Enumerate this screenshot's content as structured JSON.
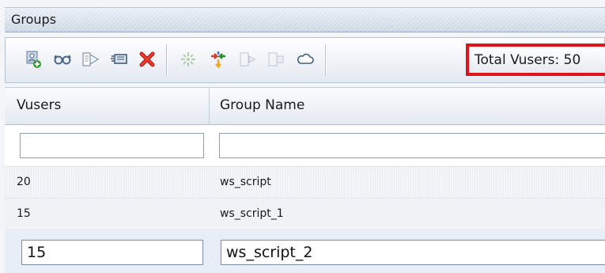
{
  "panel": {
    "title": "Groups"
  },
  "toolbar": {
    "buttons": [
      {
        "name": "add-group",
        "icon": "add-group-icon"
      },
      {
        "name": "view-script",
        "icon": "glasses-icon"
      },
      {
        "name": "run-script",
        "icon": "play-script-icon"
      },
      {
        "name": "edit-runtime",
        "icon": "edit-icon"
      },
      {
        "name": "delete-group",
        "icon": "delete-x-icon"
      },
      {
        "name": "distribute",
        "icon": "distribute-icon"
      },
      {
        "name": "change-script",
        "icon": "arrows-icon"
      },
      {
        "name": "start-group",
        "icon": "start-group-icon"
      },
      {
        "name": "stop-group",
        "icon": "stop-group-icon"
      },
      {
        "name": "cloud",
        "icon": "cloud-icon"
      }
    ],
    "total_vusers_label": "Total Vusers: 50",
    "highlight_color": "#e0131a"
  },
  "table": {
    "columns": [
      "Vusers",
      "Group Name"
    ],
    "filter": {
      "vusers": "",
      "group_name": ""
    },
    "rows": [
      {
        "vusers": "20",
        "group_name": "ws_script"
      },
      {
        "vusers": "15",
        "group_name": "ws_script_1"
      }
    ],
    "editing_row": {
      "vusers": "15",
      "group_name": "ws_script_2"
    }
  }
}
